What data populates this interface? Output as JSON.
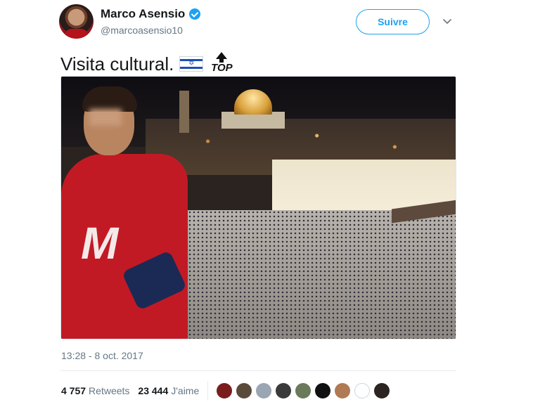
{
  "user": {
    "display_name": "Marco Asensio",
    "handle": "@marcoasensio10",
    "verified": true
  },
  "follow_button": {
    "label": "Suivre"
  },
  "menu": {
    "icon": "chevron-down-icon"
  },
  "tweet": {
    "text": "Visita cultural.",
    "emoji_top_word": "TOP",
    "flag_emoji": "israel-flag",
    "timestamp": "13:28 - 8 oct. 2017"
  },
  "stats": {
    "retweets_count": "4 757",
    "retweets_label": "Retweets",
    "likes_count": "23 444",
    "likes_label": "J'aime"
  },
  "likers": [
    {
      "color": "#7a1d1d"
    },
    {
      "color": "#5a4a3a"
    },
    {
      "color": "#9aa6b2"
    },
    {
      "color": "#3a3a3a"
    },
    {
      "color": "#6b7a5a"
    },
    {
      "color": "#111111"
    },
    {
      "color": "#b07a55"
    },
    {
      "color": "#ffffff"
    },
    {
      "color": "#2b2420"
    }
  ],
  "colors": {
    "accent": "#1da1f2",
    "secondary_text": "#657786"
  }
}
